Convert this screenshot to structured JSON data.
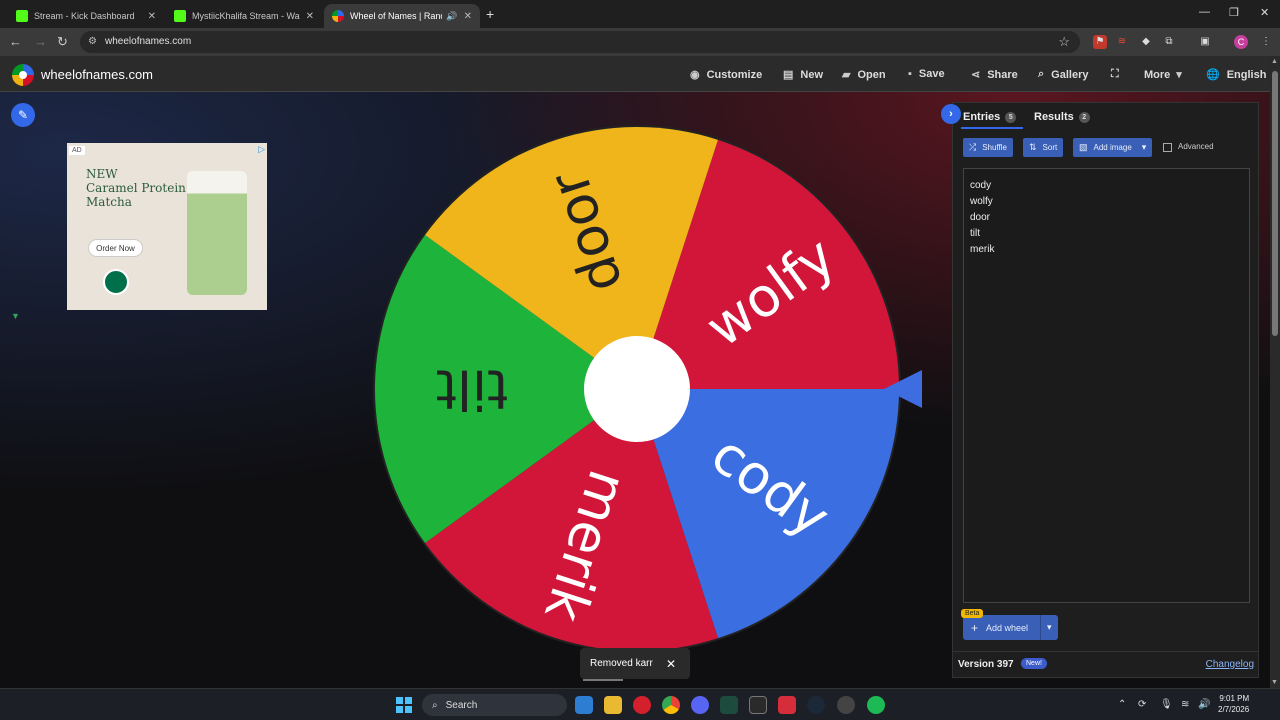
{
  "browser": {
    "tabs": [
      {
        "title": "Stream - Kick Dashboard",
        "icon": "kick-icon"
      },
      {
        "title": "MystiicKhalifa Stream - Watch Live",
        "icon": "kick-icon"
      },
      {
        "title": "Wheel of Names | Random",
        "icon": "wheel-icon"
      }
    ],
    "url": "wheelofnames.com"
  },
  "site": {
    "name": "wheelofnames.com",
    "menu": [
      {
        "label": "Customize",
        "icon": "palette-icon"
      },
      {
        "label": "New",
        "icon": "file-icon"
      },
      {
        "label": "Open",
        "icon": "folder-icon"
      },
      {
        "label": "Save",
        "icon": "save-icon"
      },
      {
        "label": "Share",
        "icon": "share-icon"
      },
      {
        "label": "Gallery",
        "icon": "search-icon"
      },
      {
        "label": "",
        "icon": "fullscreen-icon"
      },
      {
        "label": "More",
        "icon": "chevron-down-icon"
      },
      {
        "label": "English",
        "icon": "globe-icon"
      }
    ]
  },
  "ad": {
    "label": "AD",
    "lines": [
      "NEW",
      "Caramel Protein",
      "Matcha"
    ],
    "cta": "Order Now"
  },
  "wheel": {
    "segments": [
      {
        "name": "wolfy",
        "color": "#d2163a"
      },
      {
        "name": "cody",
        "color": "#3b6ee0"
      },
      {
        "name": "merik",
        "color": "#d2163a"
      },
      {
        "name": "tilt",
        "color": "#1eb43c"
      },
      {
        "name": "door",
        "color": "#f0b51b"
      }
    ]
  },
  "toast": {
    "text": "Removed karr"
  },
  "panel": {
    "tabs": [
      {
        "label": "Entries",
        "count": "5"
      },
      {
        "label": "Results",
        "count": "2"
      }
    ],
    "buttons": {
      "shuffle": "Shuffle",
      "sort": "Sort",
      "add_image": "Add image"
    },
    "advanced_label": "Advanced",
    "entries": [
      "cody",
      "wolfy",
      "door",
      "tilt",
      "merik"
    ],
    "beta": "Beta",
    "add_wheel": "Add wheel",
    "version": "Version 397",
    "new_badge": "New!",
    "changelog": "Changelog"
  },
  "taskbar": {
    "search": "Search",
    "time": "9:01 PM",
    "date": "2/7/2026"
  }
}
